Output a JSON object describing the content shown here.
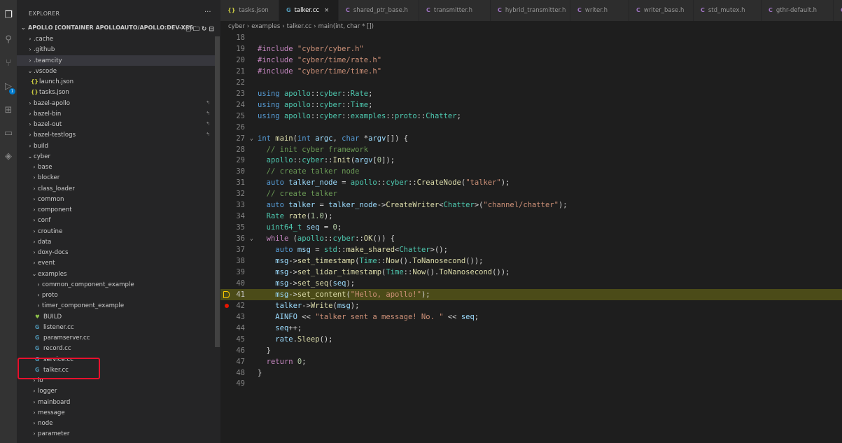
{
  "sidebar": {
    "title": "EXPLORER",
    "more": "···",
    "root_label": "APOLLO [CONTAINER APOLLOAUTO/APOLLO:DEV-X86",
    "tree": [
      {
        "label": ".cache",
        "depth": 0,
        "kind": "folder",
        "chev": "›"
      },
      {
        "label": ".github",
        "depth": 0,
        "kind": "folder",
        "chev": "›"
      },
      {
        "label": ".teamcity",
        "depth": 0,
        "kind": "folder",
        "chev": "›",
        "selected": true
      },
      {
        "label": ".vscode",
        "depth": 0,
        "kind": "folder",
        "chev": "⌄"
      },
      {
        "label": "launch.json",
        "depth": 1,
        "kind": "json",
        "icon": "{}"
      },
      {
        "label": "tasks.json",
        "depth": 1,
        "kind": "json",
        "icon": "{}"
      },
      {
        "label": "bazel-apollo",
        "depth": 0,
        "kind": "folder",
        "chev": "›",
        "marker": "↰"
      },
      {
        "label": "bazel-bin",
        "depth": 0,
        "kind": "folder",
        "chev": "›",
        "marker": "↰"
      },
      {
        "label": "bazel-out",
        "depth": 0,
        "kind": "folder",
        "chev": "›",
        "marker": "↰"
      },
      {
        "label": "bazel-testlogs",
        "depth": 0,
        "kind": "folder",
        "chev": "›",
        "marker": "↰"
      },
      {
        "label": "build",
        "depth": 0,
        "kind": "folder",
        "chev": "›"
      },
      {
        "label": "cyber",
        "depth": 0,
        "kind": "folder",
        "chev": "⌄"
      },
      {
        "label": "base",
        "depth": 1,
        "kind": "folder",
        "chev": "›"
      },
      {
        "label": "blocker",
        "depth": 1,
        "kind": "folder",
        "chev": "›"
      },
      {
        "label": "class_loader",
        "depth": 1,
        "kind": "folder",
        "chev": "›"
      },
      {
        "label": "common",
        "depth": 1,
        "kind": "folder",
        "chev": "›"
      },
      {
        "label": "component",
        "depth": 1,
        "kind": "folder",
        "chev": "›"
      },
      {
        "label": "conf",
        "depth": 1,
        "kind": "folder",
        "chev": "›"
      },
      {
        "label": "croutine",
        "depth": 1,
        "kind": "folder",
        "chev": "›"
      },
      {
        "label": "data",
        "depth": 1,
        "kind": "folder",
        "chev": "›"
      },
      {
        "label": "doxy-docs",
        "depth": 1,
        "kind": "folder",
        "chev": "›"
      },
      {
        "label": "event",
        "depth": 1,
        "kind": "folder",
        "chev": "›"
      },
      {
        "label": "examples",
        "depth": 1,
        "kind": "folder",
        "chev": "⌄"
      },
      {
        "label": "common_component_example",
        "depth": 2,
        "kind": "folder",
        "chev": "›"
      },
      {
        "label": "proto",
        "depth": 2,
        "kind": "folder",
        "chev": "›"
      },
      {
        "label": "timer_component_example",
        "depth": 2,
        "kind": "folder",
        "chev": "›"
      },
      {
        "label": "BUILD",
        "depth": 2,
        "kind": "bazel",
        "icon": "♥"
      },
      {
        "label": "listener.cc",
        "depth": 2,
        "kind": "cpp",
        "icon": "G"
      },
      {
        "label": "paramserver.cc",
        "depth": 2,
        "kind": "cpp",
        "icon": "G"
      },
      {
        "label": "record.cc",
        "depth": 2,
        "kind": "cpp",
        "icon": "G"
      },
      {
        "label": "service.cc",
        "depth": 2,
        "kind": "cpp",
        "icon": "G"
      },
      {
        "label": "talker.cc",
        "depth": 2,
        "kind": "cpp",
        "icon": "G"
      },
      {
        "label": "io",
        "depth": 1,
        "kind": "folder",
        "chev": "›"
      },
      {
        "label": "logger",
        "depth": 1,
        "kind": "folder",
        "chev": "›"
      },
      {
        "label": "mainboard",
        "depth": 1,
        "kind": "folder",
        "chev": "›"
      },
      {
        "label": "message",
        "depth": 1,
        "kind": "folder",
        "chev": "›"
      },
      {
        "label": "node",
        "depth": 1,
        "kind": "folder",
        "chev": "›"
      },
      {
        "label": "parameter",
        "depth": 1,
        "kind": "folder",
        "chev": "›"
      }
    ]
  },
  "activity": {
    "badge": "1"
  },
  "tabs": [
    {
      "label": "tasks.json",
      "icon": "{}",
      "kind": "j"
    },
    {
      "label": "talker.cc",
      "icon": "G",
      "kind": "g",
      "active": true,
      "close": "×"
    },
    {
      "label": "shared_ptr_base.h",
      "icon": "C",
      "kind": "c"
    },
    {
      "label": "transmitter.h",
      "icon": "C",
      "kind": "c"
    },
    {
      "label": "hybrid_transmitter.h",
      "icon": "C",
      "kind": "c"
    },
    {
      "label": "writer.h",
      "icon": "C",
      "kind": "c"
    },
    {
      "label": "writer_base.h",
      "icon": "C",
      "kind": "c"
    },
    {
      "label": "std_mutex.h",
      "icon": "C",
      "kind": "c"
    },
    {
      "label": "gthr-default.h",
      "icon": "C",
      "kind": "c"
    },
    {
      "label": "t",
      "icon": "C",
      "kind": "c"
    }
  ],
  "breadcrumb": {
    "parts": [
      "cyber",
      "examples",
      "talker.cc",
      "main(int, char * [])"
    ],
    "sep": "›"
  },
  "code": {
    "current_line": 41,
    "breakpoint_line": 42,
    "lines": [
      {
        "n": 18,
        "html": ""
      },
      {
        "n": 19,
        "html": "<span class='k-pre'>#include</span> <span class='k-str'>\"cyber/cyber.h\"</span>"
      },
      {
        "n": 20,
        "html": "<span class='k-pre'>#include</span> <span class='k-str'>\"cyber/time/rate.h\"</span>"
      },
      {
        "n": 21,
        "html": "<span class='k-pre'>#include</span> <span class='k-str'>\"cyber/time/time.h\"</span>"
      },
      {
        "n": 22,
        "html": ""
      },
      {
        "n": 23,
        "html": "<span class='k-kw'>using</span> <span class='k-ns'>apollo</span>::<span class='k-ns'>cyber</span>::<span class='k-type'>Rate</span>;"
      },
      {
        "n": 24,
        "html": "<span class='k-kw'>using</span> <span class='k-ns'>apollo</span>::<span class='k-ns'>cyber</span>::<span class='k-type'>Time</span>;"
      },
      {
        "n": 25,
        "html": "<span class='k-kw'>using</span> <span class='k-ns'>apollo</span>::<span class='k-ns'>cyber</span>::<span class='k-ns'>examples</span>::<span class='k-ns'>proto</span>::<span class='k-type'>Chatter</span>;"
      },
      {
        "n": 26,
        "html": ""
      },
      {
        "n": 27,
        "html": "<span class='k-kw'>int</span> <span class='k-fn'>main</span>(<span class='k-kw'>int</span> <span class='k-var'>argc</span>, <span class='k-kw'>char</span> *<span class='k-var'>argv</span>[]) {",
        "fold": true
      },
      {
        "n": 28,
        "html": "  <span class='k-com'>// init cyber framework</span>"
      },
      {
        "n": 29,
        "html": "  <span class='k-ns'>apollo</span>::<span class='k-ns'>cyber</span>::<span class='k-fn'>Init</span>(<span class='k-var'>argv</span>[<span class='k-num'>0</span>]);"
      },
      {
        "n": 30,
        "html": "  <span class='k-com'>// create talker node</span>"
      },
      {
        "n": 31,
        "html": "  <span class='k-kw'>auto</span> <span class='k-var'>talker_node</span> = <span class='k-ns'>apollo</span>::<span class='k-ns'>cyber</span>::<span class='k-fn'>CreateNode</span>(<span class='k-str'>\"talker\"</span>);"
      },
      {
        "n": 32,
        "html": "  <span class='k-com'>// create talker</span>"
      },
      {
        "n": 33,
        "html": "  <span class='k-kw'>auto</span> <span class='k-var'>talker</span> = <span class='k-var'>talker_node</span>-&gt;<span class='k-fn'>CreateWriter</span>&lt;<span class='k-type'>Chatter</span>&gt;(<span class='k-str'>\"channel/chatter\"</span>);"
      },
      {
        "n": 34,
        "html": "  <span class='k-type'>Rate</span> <span class='k-fn'>rate</span>(<span class='k-num'>1.0</span>);"
      },
      {
        "n": 35,
        "html": "  <span class='k-type'>uint64_t</span> <span class='k-var'>seq</span> = <span class='k-num'>0</span>;"
      },
      {
        "n": 36,
        "html": "  <span class='k-ctl'>while</span> (<span class='k-ns'>apollo</span>::<span class='k-ns'>cyber</span>::<span class='k-fn'>OK</span>()) {",
        "fold": true
      },
      {
        "n": 37,
        "html": "    <span class='k-kw'>auto</span> <span class='k-var'>msg</span> = <span class='k-ns'>std</span>::<span class='k-fn'>make_shared</span>&lt;<span class='k-type'>Chatter</span>&gt;();"
      },
      {
        "n": 38,
        "html": "    <span class='k-var'>msg</span>-&gt;<span class='k-fn'>set_timestamp</span>(<span class='k-type'>Time</span>::<span class='k-fn'>Now</span>().<span class='k-fn'>ToNanosecond</span>());"
      },
      {
        "n": 39,
        "html": "    <span class='k-var'>msg</span>-&gt;<span class='k-fn'>set_lidar_timestamp</span>(<span class='k-type'>Time</span>::<span class='k-fn'>Now</span>().<span class='k-fn'>ToNanosecond</span>());"
      },
      {
        "n": 40,
        "html": "    <span class='k-var'>msg</span>-&gt;<span class='k-fn'>set_seq</span>(<span class='k-var'>seq</span>);"
      },
      {
        "n": 41,
        "html": "    <span class='k-var'>msg</span>-&gt;<span class='k-fn'>set_content</span>(<span class='k-str'>\"Hello, apollo!\"</span>);"
      },
      {
        "n": 42,
        "html": "    <span class='k-var'>talker</span>-&gt;<span class='k-fn'>Write</span>(<span class='k-var'>msg</span>);"
      },
      {
        "n": 43,
        "html": "    <span class='k-var'>AINFO</span> &lt;&lt; <span class='k-str'>\"talker sent a message! No. \"</span> &lt;&lt; <span class='k-var'>seq</span>;"
      },
      {
        "n": 44,
        "html": "    <span class='k-var'>seq</span>++;"
      },
      {
        "n": 45,
        "html": "    <span class='k-var'>rate</span>.<span class='k-fn'>Sleep</span>();"
      },
      {
        "n": 46,
        "html": "  }"
      },
      {
        "n": 47,
        "html": "  <span class='k-ctl'>return</span> <span class='k-num'>0</span>;"
      },
      {
        "n": 48,
        "html": "}"
      },
      {
        "n": 49,
        "html": ""
      }
    ]
  }
}
